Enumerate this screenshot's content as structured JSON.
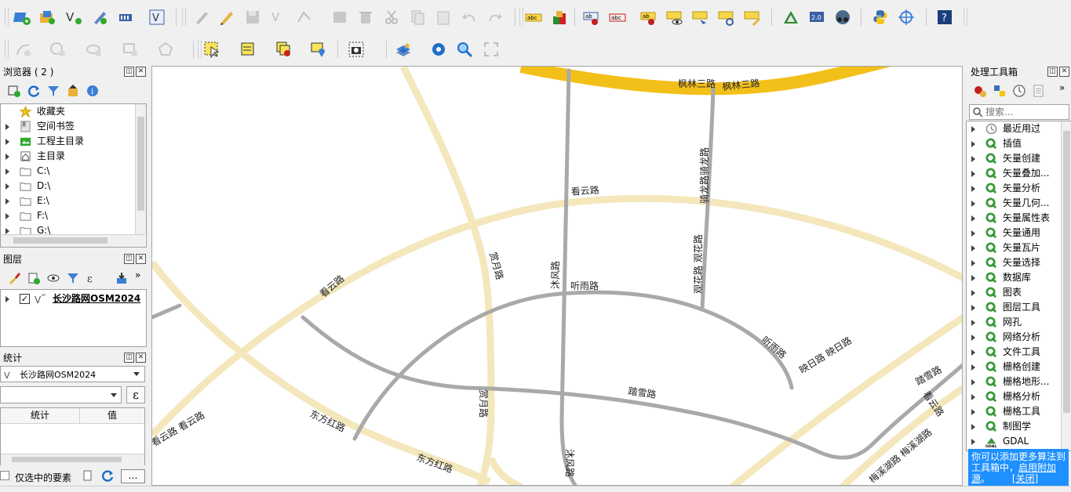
{
  "browser_panel": {
    "title": "浏览器 ( 2 )",
    "items": [
      {
        "label": "收藏夹",
        "icon": "star-icon",
        "expandable": false
      },
      {
        "label": "空间书签",
        "icon": "bookmark-icon",
        "expandable": true
      },
      {
        "label": "工程主目录",
        "icon": "project-home-icon",
        "expandable": true
      },
      {
        "label": "主目录",
        "icon": "home-folder-icon",
        "expandable": true
      },
      {
        "label": "C:\\",
        "icon": "folder-icon",
        "expandable": true
      },
      {
        "label": "D:\\",
        "icon": "folder-icon",
        "expandable": true
      },
      {
        "label": "E:\\",
        "icon": "folder-icon",
        "expandable": true
      },
      {
        "label": "F:\\",
        "icon": "folder-icon",
        "expandable": true
      },
      {
        "label": "G:\\",
        "icon": "folder-icon",
        "expandable": true
      }
    ]
  },
  "layers_panel": {
    "title": "图层",
    "layers": [
      {
        "name": "长沙路网OSM2024",
        "checked": true
      }
    ]
  },
  "stats_panel": {
    "title": "统计",
    "layer_select": "长沙路网OSM2024",
    "field_value": "",
    "expr_button": "ε",
    "col_stat": "统计",
    "col_value": "值",
    "selected_only_label": "仅选中的要素",
    "more_button": "…"
  },
  "processing_panel": {
    "title": "处理工具箱",
    "search_placeholder": "搜索...",
    "items": [
      {
        "label": "最近用过",
        "icon": "clock-icon"
      },
      {
        "label": "插值",
        "icon": "qgis-icon"
      },
      {
        "label": "矢量创建",
        "icon": "qgis-icon"
      },
      {
        "label": "矢量叠加...",
        "icon": "qgis-icon"
      },
      {
        "label": "矢量分析",
        "icon": "qgis-icon"
      },
      {
        "label": "矢量几何...",
        "icon": "qgis-icon"
      },
      {
        "label": "矢量属性表",
        "icon": "qgis-icon"
      },
      {
        "label": "矢量通用",
        "icon": "qgis-icon"
      },
      {
        "label": "矢量瓦片",
        "icon": "qgis-icon"
      },
      {
        "label": "矢量选择",
        "icon": "qgis-icon"
      },
      {
        "label": "数据库",
        "icon": "qgis-icon"
      },
      {
        "label": "图表",
        "icon": "qgis-icon"
      },
      {
        "label": "图层工具",
        "icon": "qgis-icon"
      },
      {
        "label": "网孔",
        "icon": "qgis-icon"
      },
      {
        "label": "网络分析",
        "icon": "qgis-icon"
      },
      {
        "label": "文件工具",
        "icon": "qgis-icon"
      },
      {
        "label": "栅格创建",
        "icon": "qgis-icon"
      },
      {
        "label": "栅格地形...",
        "icon": "qgis-icon"
      },
      {
        "label": "栅格分析",
        "icon": "qgis-icon"
      },
      {
        "label": "栅格工具",
        "icon": "qgis-icon"
      },
      {
        "label": "制图学",
        "icon": "qgis-icon"
      },
      {
        "label": "GDAL",
        "icon": "gdal-icon"
      }
    ],
    "info_text": "你可以添加更多算法到工具箱中，",
    "info_link": "启用附加源",
    "info_tail": "。",
    "close_link": "[关闭]"
  },
  "map_labels": {
    "fenglin_a": "枫林三路",
    "fenglin_b": "枫林三路",
    "qilong": "骑龙路骑龙路",
    "guanhua": "观花路 观花路",
    "kanyun_top": "看云路",
    "kanyun_left": "看云路",
    "kanyun_bottom": "看云路 看云路",
    "shangyue_top": "赏月路",
    "shangyue_bottom": "赏月路",
    "mufeng_top": "沐风路",
    "mufeng_bottom": "沐风路",
    "tingyu_top": "听雨路",
    "tingyu_right": "听雨路",
    "yingri": "映日路 映日路",
    "taxue_center": "踏雪路",
    "taxue_right": "踏雪路",
    "kanyun_right": "看云路",
    "meixi": "梅溪湖路 梅溪湖路",
    "dongfang_a": "东方红路",
    "dongfang_b": "东方红路"
  },
  "colors": {
    "major_road": "#f3c01a",
    "secondary_road": "#f4e7bc",
    "minor_road": "#a9a9a9",
    "map_background": "#ffffff",
    "info_box": "#1e90ff"
  }
}
